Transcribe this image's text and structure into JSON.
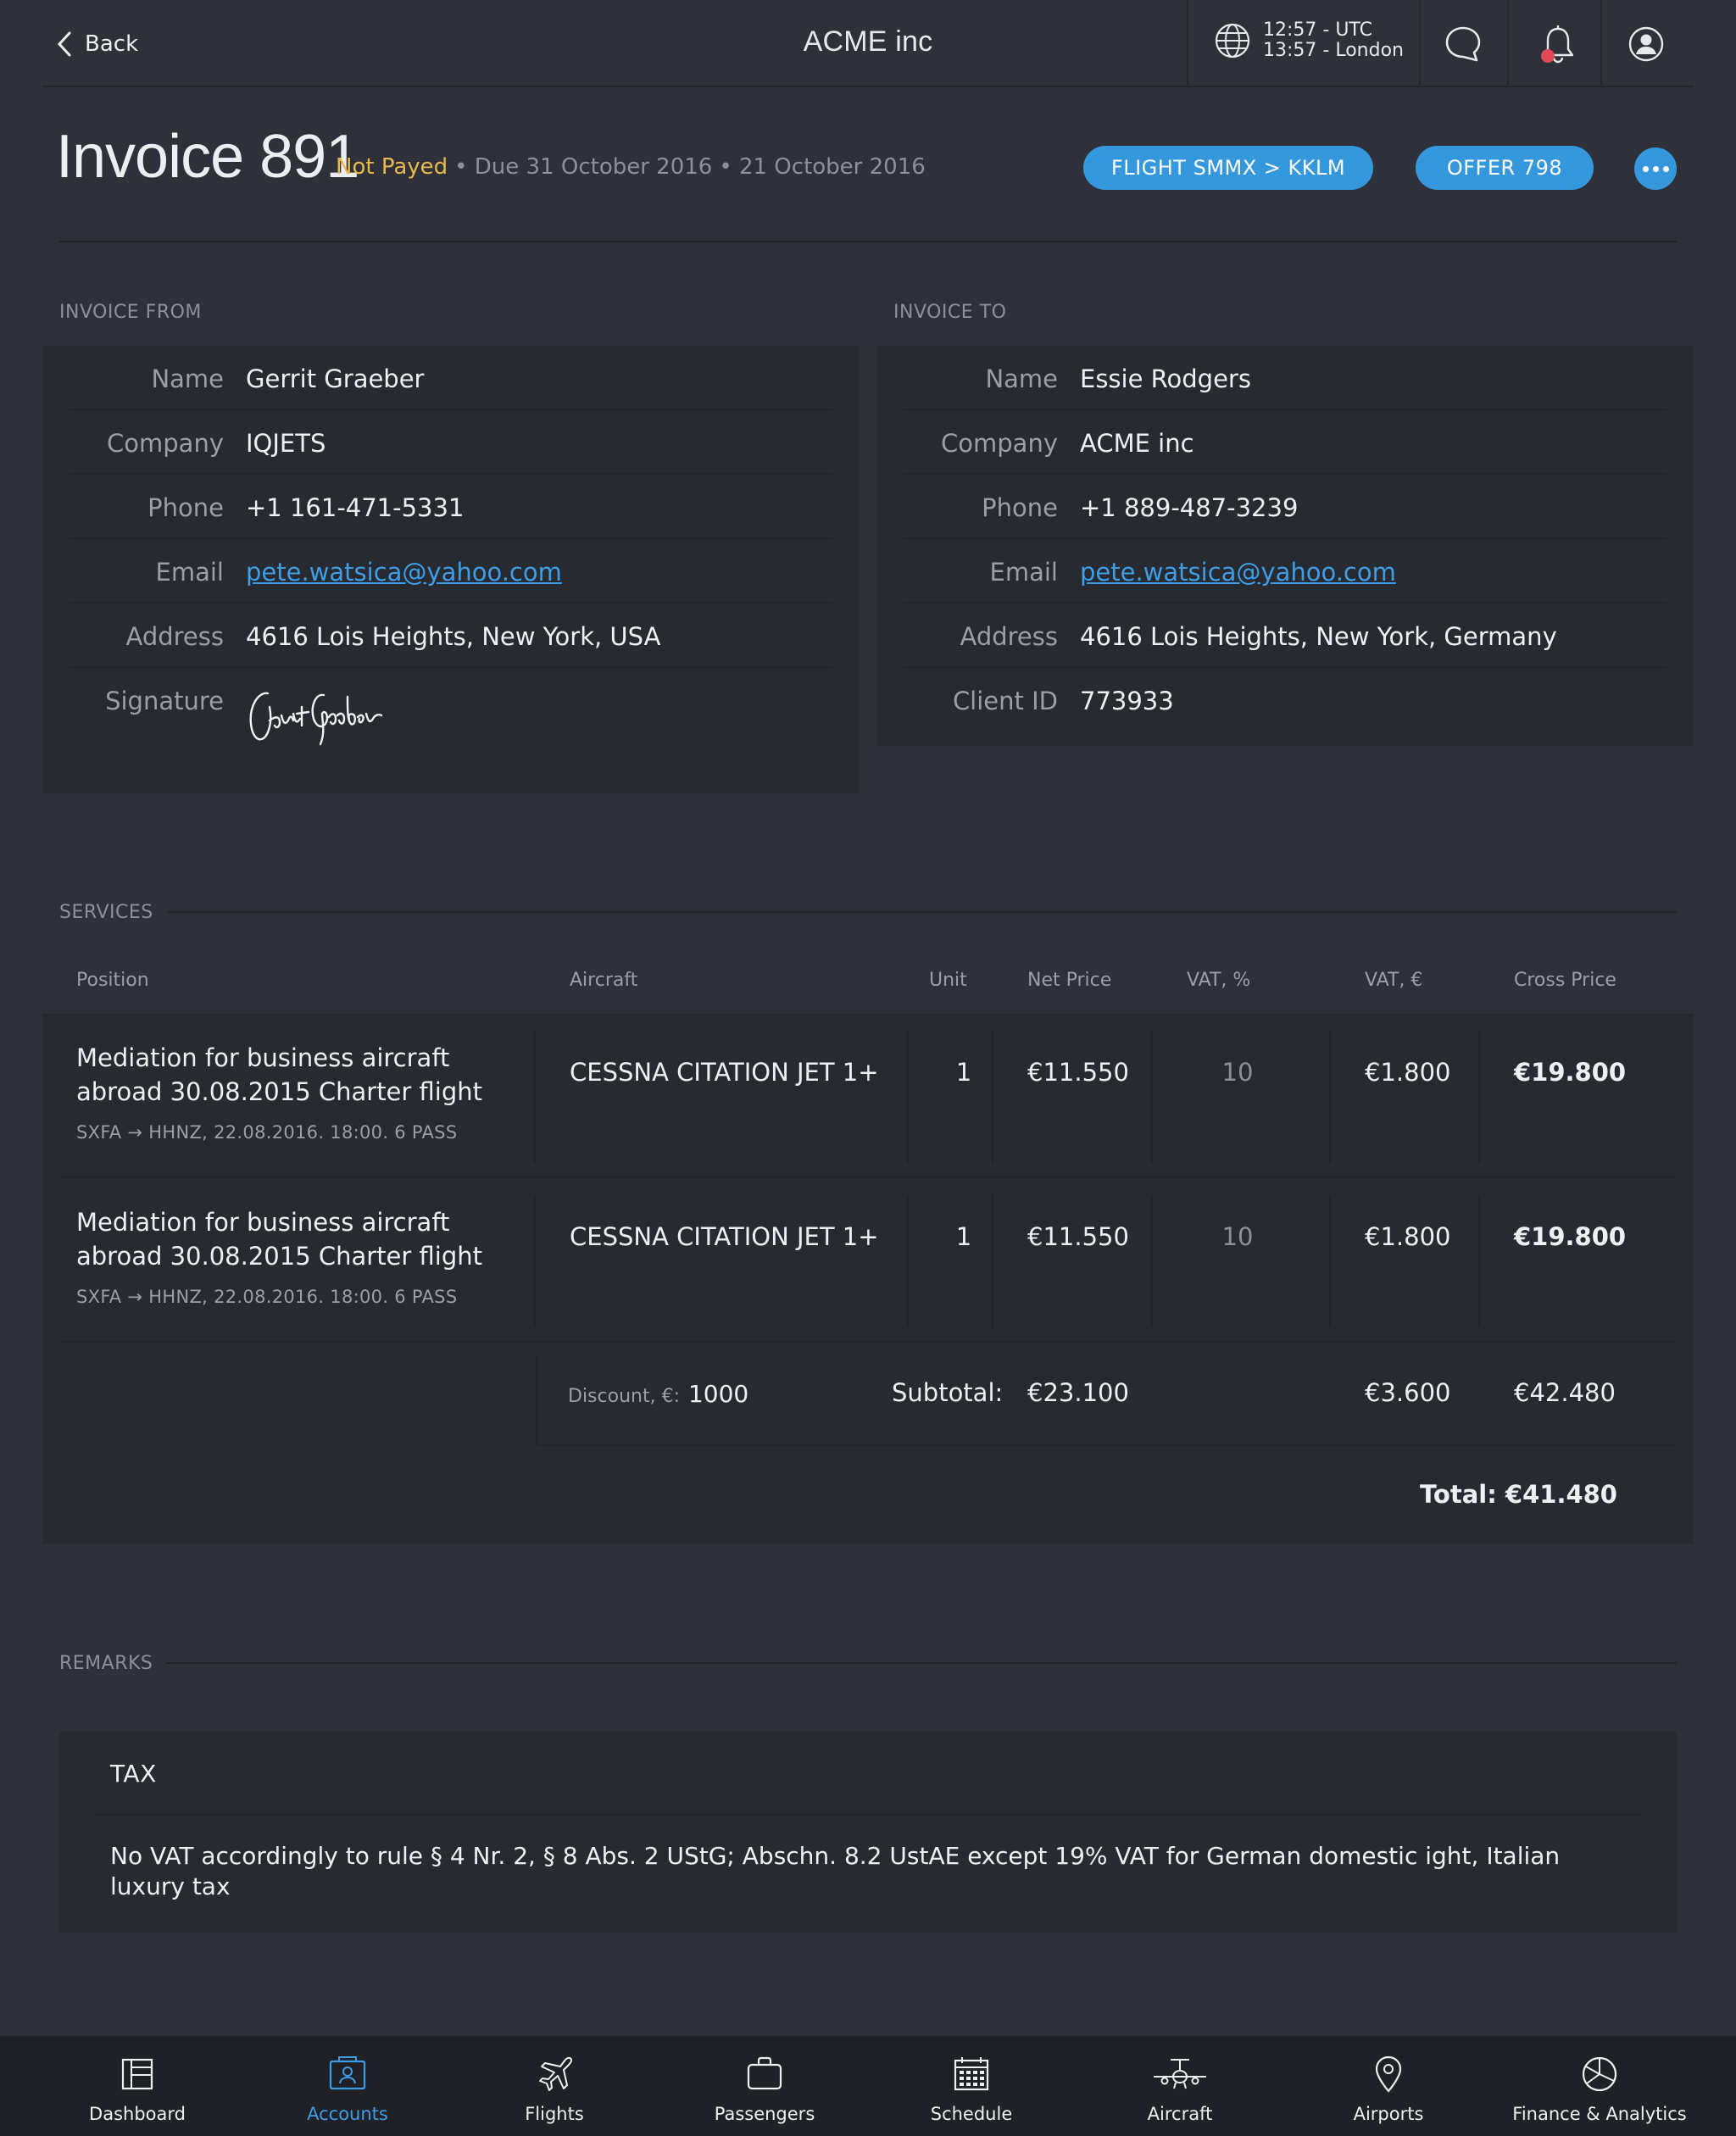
{
  "header": {
    "back_label": "Back",
    "app_title": "ACME inc",
    "clock_utc": "12:57 - UTC",
    "clock_local": "13:57 - London"
  },
  "invoice": {
    "title": "Invoice 891",
    "status": "Not Payed",
    "due": "• Due 31 October 2016",
    "date": "• 21 October 2016",
    "flight_button": "FLIGHT SMMX > KKLM",
    "offer_button": "OFFER 798"
  },
  "invoice_from": {
    "label": "INVOICE FROM",
    "rows": [
      {
        "key": "Name",
        "value": "Gerrit Graeber"
      },
      {
        "key": "Company",
        "value": "IQJETS"
      },
      {
        "key": "Phone",
        "value": "+1 161-471-5331"
      },
      {
        "key": "Email",
        "value": "pete.watsica@yahoo.com"
      },
      {
        "key": "Address",
        "value": "4616 Lois Heights, New York, USA"
      },
      {
        "key": "Signature",
        "value": "Gerrit Graeber"
      }
    ]
  },
  "invoice_to": {
    "label": "INVOICE TO",
    "rows": [
      {
        "key": "Name",
        "value": "Essie Rodgers"
      },
      {
        "key": "Company",
        "value": "ACME inc"
      },
      {
        "key": "Phone",
        "value": "+1 889-487-3239"
      },
      {
        "key": "Email",
        "value": "pete.watsica@yahoo.com"
      },
      {
        "key": "Address",
        "value": "4616 Lois Heights, New York, Germany"
      },
      {
        "key": "Client ID",
        "value": "773933"
      }
    ]
  },
  "services": {
    "label": "SERVICES",
    "columns": [
      "Position",
      "Aircraft",
      "Unit",
      "Net Price",
      "VAT, %",
      "VAT, €",
      "Cross Price"
    ],
    "rows": [
      {
        "title_line1": "Mediation for business aircraft",
        "title_line2": "abroad 30.08.2015 Charter flight",
        "subtitle": "SXFA → HHNZ, 22.08.2016. 18:00. 6 PASS",
        "aircraft": "CESSNA CITATION JET 1+",
        "unit": "1",
        "net_price": "€11.550",
        "vat_percent": "10",
        "vat_eur": "€1.800",
        "cross_price": "€19.800"
      },
      {
        "title_line1": "Mediation for business aircraft",
        "title_line2": "abroad 30.08.2015 Charter flight",
        "subtitle": "SXFA → HHNZ, 22.08.2016. 18:00. 6 PASS",
        "aircraft": "CESSNA CITATION JET 1+",
        "unit": "1",
        "net_price": "€11.550",
        "vat_percent": "10",
        "vat_eur": "€1.800",
        "cross_price": "€19.800"
      }
    ],
    "discount_label": "Discount, €:",
    "discount_value": "1000",
    "subtotal_label": "Subtotal:",
    "subtotal_net": "€23.100",
    "subtotal_vat": "€3.600",
    "subtotal_cross": "€42.480",
    "total": "Total: €41.480"
  },
  "remarks": {
    "label": "REMARKS",
    "heading": "TAX",
    "text": "No VAT accordingly to rule § 4 Nr. 2, § 8 Abs. 2 UStG; Abschn. 8.2 UstAE except 19% VAT for German domestic ight, Italian luxury tax"
  },
  "nav": {
    "items": [
      {
        "label": "Dashboard",
        "icon": "dashboard-icon"
      },
      {
        "label": "Accounts",
        "icon": "accounts-icon",
        "active": true
      },
      {
        "label": "Flights",
        "icon": "airplane-icon"
      },
      {
        "label": "Passengers",
        "icon": "briefcase-icon"
      },
      {
        "label": "Schedule",
        "icon": "calendar-icon"
      },
      {
        "label": "Aircraft",
        "icon": "aircraft-front-icon"
      },
      {
        "label": "Airports",
        "icon": "location-pin-icon"
      },
      {
        "label": "Finance & Analytics",
        "icon": "pie-chart-icon"
      }
    ]
  },
  "colors": {
    "background": "#2e313a",
    "panel": "#282a32",
    "accent": "#3597dc",
    "status_warning": "#e8b94a",
    "notification": "#e24a57",
    "nav_background": "#1f2127"
  }
}
